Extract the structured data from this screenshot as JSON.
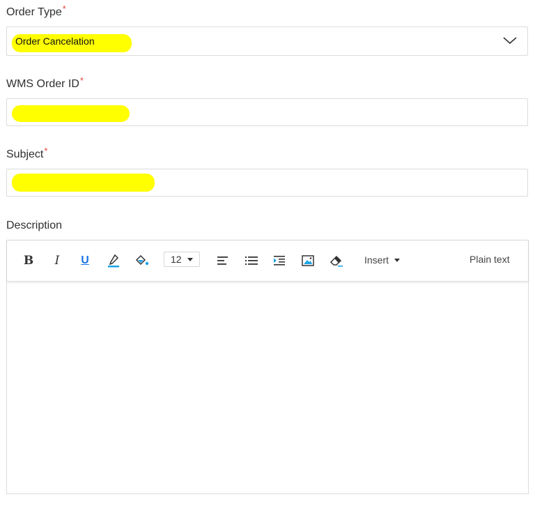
{
  "fields": {
    "order_type": {
      "label": "Order Type",
      "required_mark": "*",
      "value": "Order Cancelation"
    },
    "wms_order_id": {
      "label": "WMS Order ID",
      "required_mark": "*"
    },
    "subject": {
      "label": "Subject",
      "required_mark": "*"
    },
    "description": {
      "label": "Description"
    }
  },
  "toolbar": {
    "bold": "B",
    "italic": "I",
    "underline": "U",
    "font_size": "12",
    "insert_label": "Insert",
    "plain_text_label": "Plain text"
  },
  "colors": {
    "highlight": "#ffff00",
    "required": "#e0463c",
    "accent_blue": "#1a73e8"
  },
  "icons": [
    "bold-icon",
    "italic-icon",
    "underline-icon",
    "text-color-icon",
    "fill-color-icon",
    "align-left-icon",
    "bullet-list-icon",
    "indent-icon",
    "image-icon",
    "eraser-icon",
    "chevron-down-icon"
  ]
}
